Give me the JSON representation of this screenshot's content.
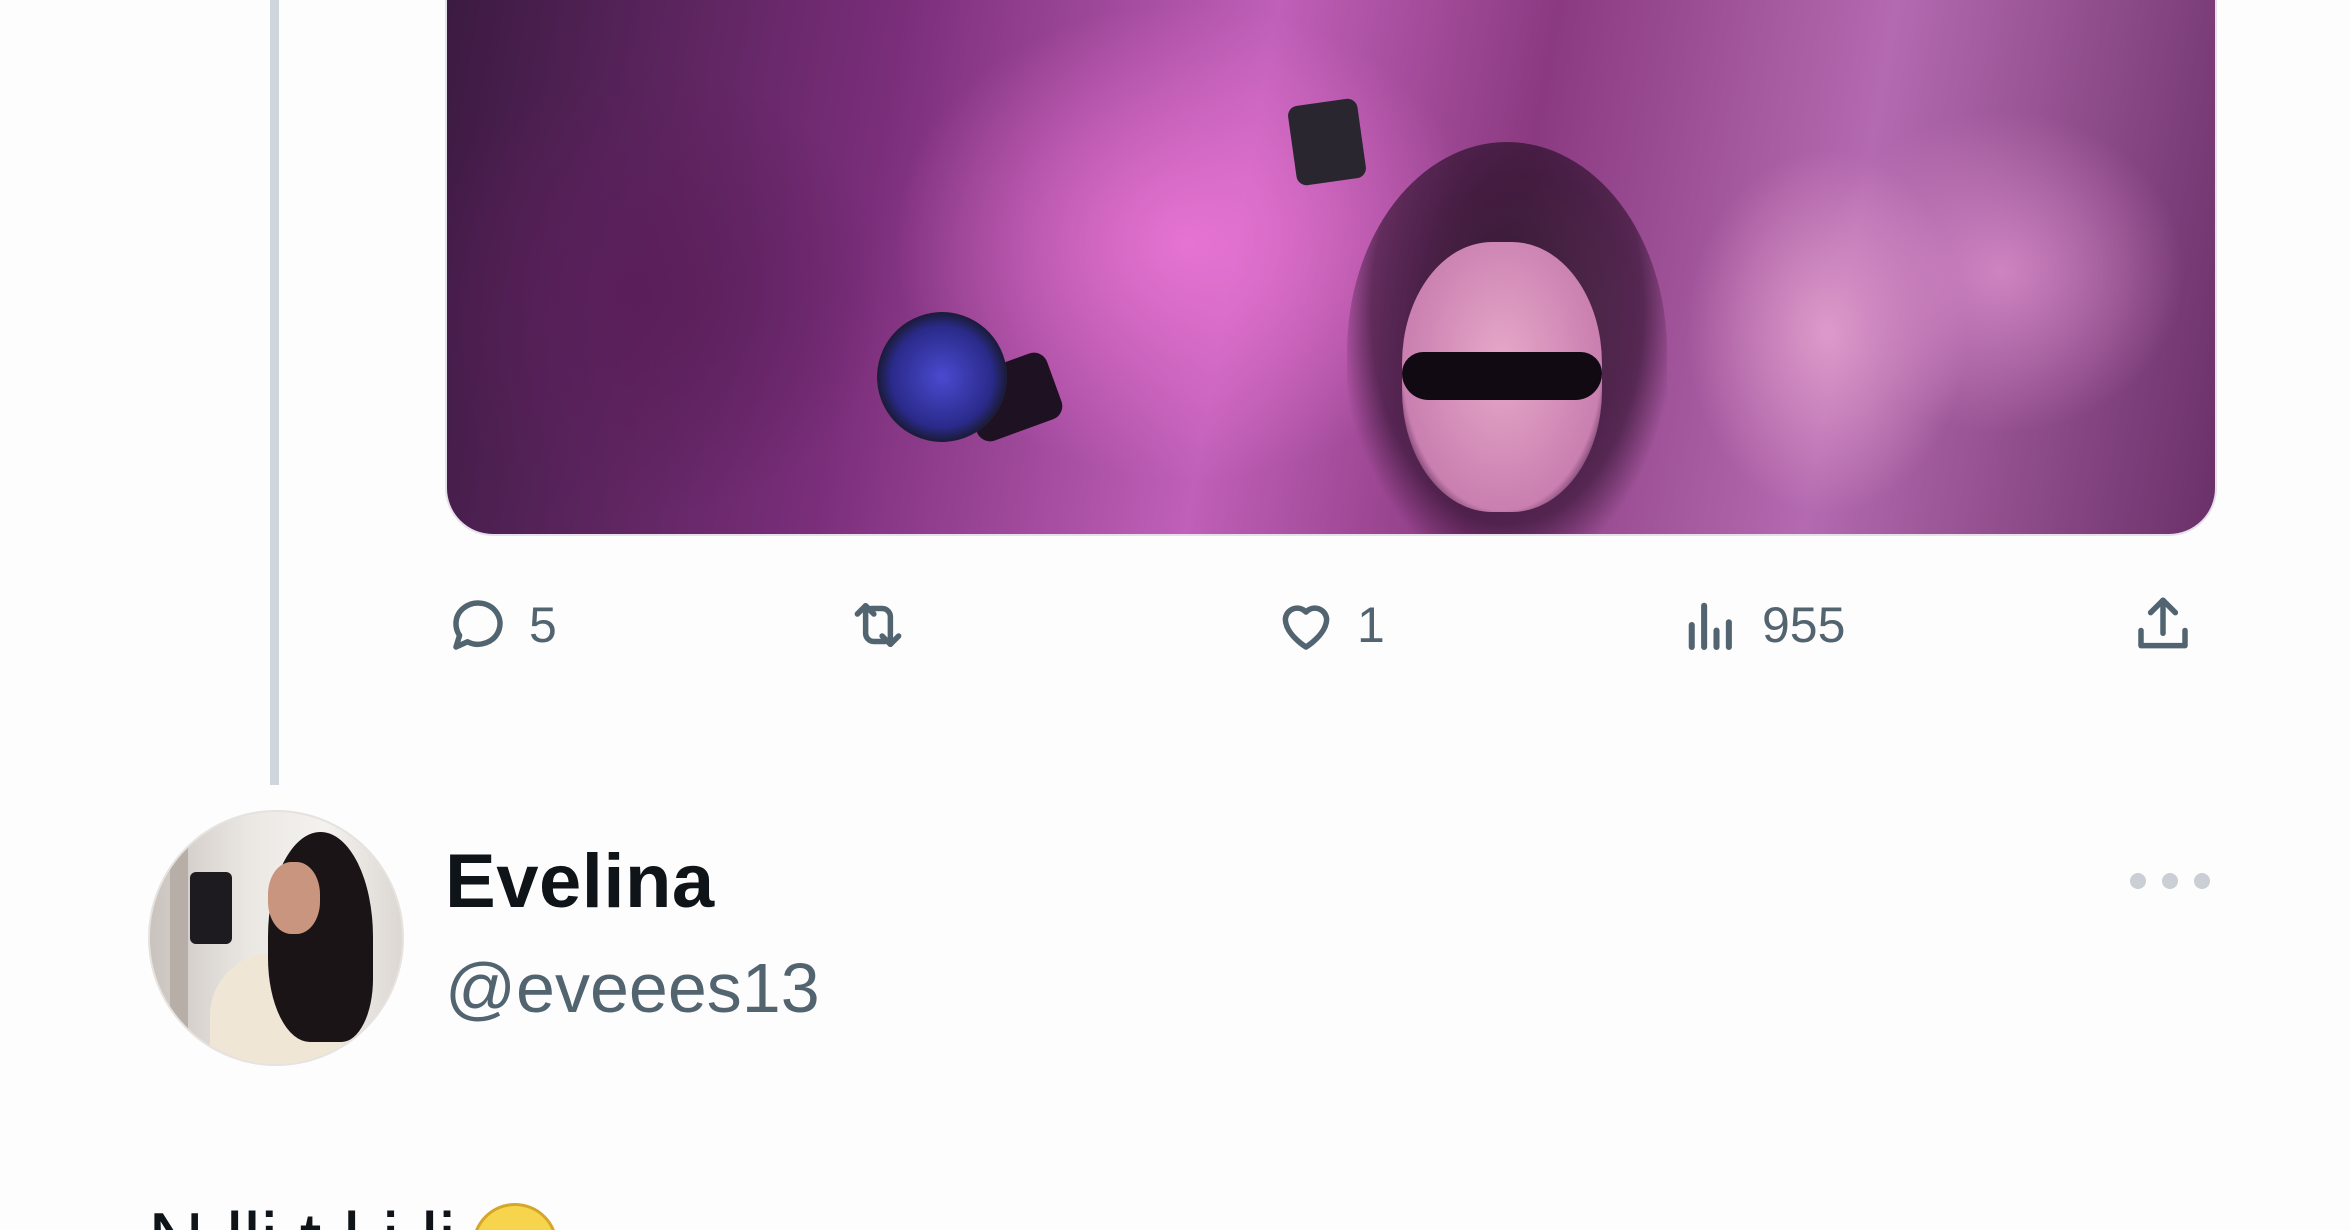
{
  "tweet": {
    "actions": {
      "reply_count": "5",
      "retweet_count": "",
      "like_count": "1",
      "views_count": "955"
    },
    "media_alt": ""
  },
  "reply": {
    "display_name": "Evelina",
    "handle": "@eveees13",
    "text_partial": "N   lli        t   l           i         li",
    "emoji": ""
  },
  "icons": {
    "reply": "reply-icon",
    "retweet": "retweet-icon",
    "like": "heart-icon",
    "views": "views-icon",
    "share": "share-icon",
    "more": "more-icon"
  },
  "colors": {
    "text_primary": "#0f1419",
    "text_secondary": "#536471",
    "thread_line": "#cfd5dc"
  }
}
